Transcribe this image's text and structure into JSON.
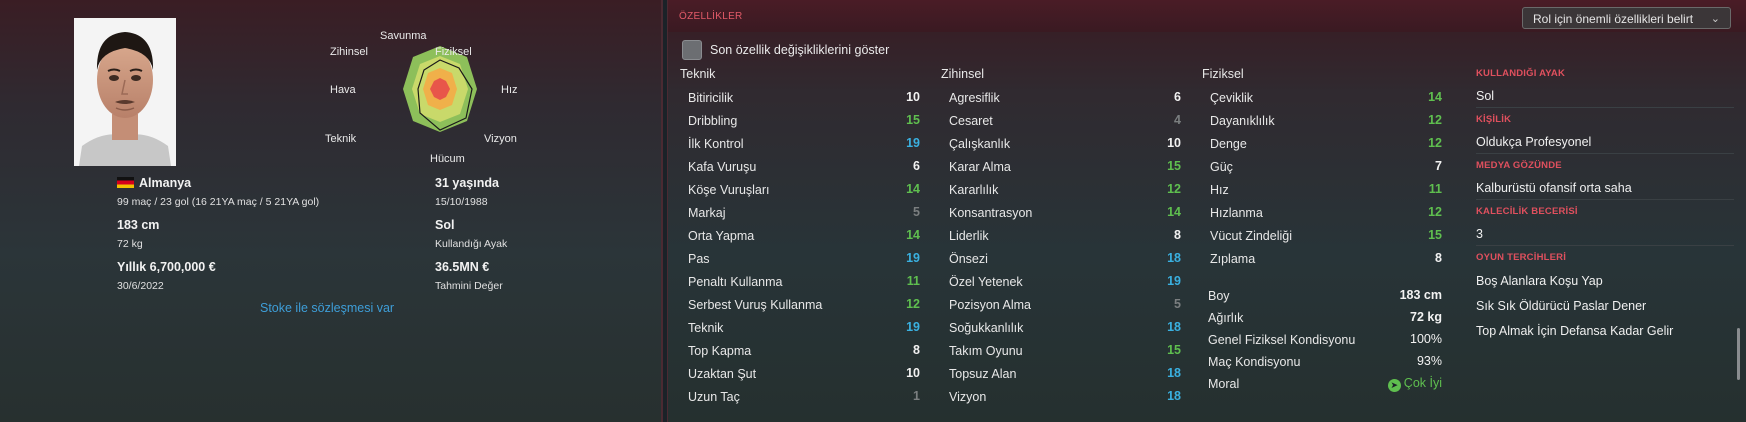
{
  "profile": {
    "radar_labels": {
      "defense": "Savunma",
      "physical": "Fiziksel",
      "mental": "Zihinsel",
      "aerial": "Hava",
      "speed": "Hız",
      "technique": "Teknik",
      "vision": "Vizyon",
      "attack": "Hücum"
    },
    "nationality": "Almanya",
    "caps": "99 maç / 23 gol (16 21YA maç / 5 21YA gol)",
    "height": "183 cm",
    "weight": "72 kg",
    "wage": "Yıllık 6,700,000 €",
    "contract_end": "30/6/2022",
    "age": "31 yaşında",
    "dob": "15/10/1988",
    "preferred_foot": "Sol",
    "preferred_foot_label": "Kullandığı Ayak",
    "value": "36.5MN €",
    "value_label": "Tahmini Değer",
    "contract_link": "Stoke ile sözleşmesi var"
  },
  "attributes": {
    "header": "ÖZELLİKLER",
    "role_dropdown": "Rol için önemli özellikleri belirt",
    "checkbox_label": "Son özellik değişikliklerini göster",
    "technical": {
      "title": "Teknik",
      "items": [
        {
          "name": "Bitiricilik",
          "value": "10"
        },
        {
          "name": "Dribbling",
          "value": "15"
        },
        {
          "name": "İlk Kontrol",
          "value": "19"
        },
        {
          "name": "Kafa Vuruşu",
          "value": "6"
        },
        {
          "name": "Köşe Vuruşları",
          "value": "14"
        },
        {
          "name": "Markaj",
          "value": "5"
        },
        {
          "name": "Orta Yapma",
          "value": "14"
        },
        {
          "name": "Pas",
          "value": "19"
        },
        {
          "name": "Penaltı Kullanma",
          "value": "11"
        },
        {
          "name": "Serbest Vuruş Kullanma",
          "value": "12"
        },
        {
          "name": "Teknik",
          "value": "19"
        },
        {
          "name": "Top Kapma",
          "value": "8"
        },
        {
          "name": "Uzaktan Şut",
          "value": "10"
        },
        {
          "name": "Uzun Taç",
          "value": "1"
        }
      ]
    },
    "mental": {
      "title": "Zihinsel",
      "items": [
        {
          "name": "Agresiflik",
          "value": "6"
        },
        {
          "name": "Cesaret",
          "value": "4"
        },
        {
          "name": "Çalışkanlık",
          "value": "10"
        },
        {
          "name": "Karar Alma",
          "value": "15"
        },
        {
          "name": "Kararlılık",
          "value": "12"
        },
        {
          "name": "Konsantrasyon",
          "value": "14"
        },
        {
          "name": "Liderlik",
          "value": "8"
        },
        {
          "name": "Önsezi",
          "value": "18"
        },
        {
          "name": "Özel Yetenek",
          "value": "19"
        },
        {
          "name": "Pozisyon Alma",
          "value": "5"
        },
        {
          "name": "Soğukkanlılık",
          "value": "18"
        },
        {
          "name": "Takım Oyunu",
          "value": "15"
        },
        {
          "name": "Topsuz Alan",
          "value": "18"
        },
        {
          "name": "Vizyon",
          "value": "18"
        }
      ]
    },
    "physical": {
      "title": "Fiziksel",
      "items": [
        {
          "name": "Çeviklik",
          "value": "14"
        },
        {
          "name": "Dayanıklılık",
          "value": "12"
        },
        {
          "name": "Denge",
          "value": "12"
        },
        {
          "name": "Güç",
          "value": "7"
        },
        {
          "name": "Hız",
          "value": "11"
        },
        {
          "name": "Hızlanma",
          "value": "12"
        },
        {
          "name": "Vücut Zindeliği",
          "value": "15"
        },
        {
          "name": "Zıplama",
          "value": "8"
        }
      ]
    },
    "physical_stats": [
      {
        "name": "Boy",
        "value": "183 cm"
      },
      {
        "name": "Ağırlık",
        "value": "72 kg"
      },
      {
        "name": "Genel Fiziksel Kondisyonu",
        "value": "100%"
      },
      {
        "name": "Maç Kondisyonu",
        "value": "93%"
      },
      {
        "name": "Moral",
        "value": "Çok İyi"
      }
    ]
  },
  "info": {
    "foot_head": "KULLANDIĞI AYAK",
    "foot_val": "Sol",
    "personality_head": "KİŞİLİK",
    "personality_val": "Oldukça Profesyonel",
    "media_head": "MEDYA GÖZÜNDE",
    "media_val": "Kalburüstü ofansif orta saha",
    "gk_head": "KALECİLİK BECERİSİ",
    "gk_val": "3",
    "prefs_head": "OYUN TERCİHLERİ",
    "prefs": [
      "Boş Alanlara Koşu Yap",
      "Sık Sık Öldürücü Paslar Dener",
      "Top Almak İçin Defansa Kadar Gelir"
    ]
  },
  "colors": {
    "accent_red": "#e0505e",
    "green": "#5fbf4f",
    "cyan": "#3ab0e0",
    "link_blue": "#3e9ed8"
  }
}
